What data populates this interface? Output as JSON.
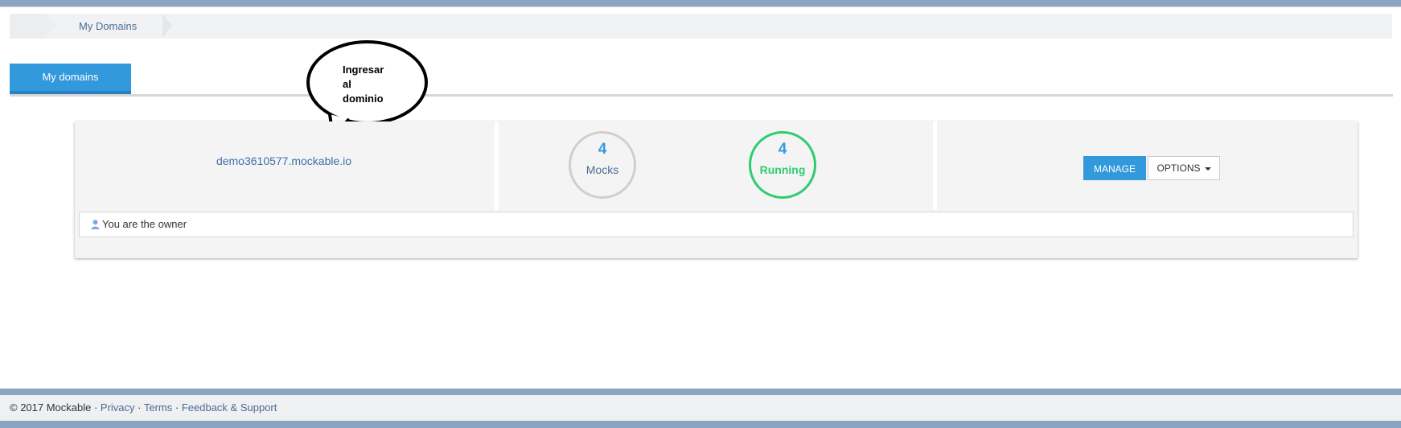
{
  "breadcrumb": {
    "current": "My Domains"
  },
  "tabs": [
    {
      "label": "My domains",
      "active": true
    }
  ],
  "callout": {
    "text": "Ingresar\nal\ndominio"
  },
  "domain": {
    "name": "demo3610577.mockable.io",
    "mocks": {
      "count": "4",
      "label": "Mocks"
    },
    "running": {
      "count": "4",
      "label": "Running"
    },
    "manage_label": "MANAGE",
    "options_label": "OPTIONS",
    "owner_text": "You are the owner"
  },
  "footer": {
    "copyright": "© 2017 Mockable · ",
    "privacy": "Privacy",
    "sep1": " · ",
    "terms": "Terms",
    "sep2": " · ",
    "feedback": "Feedback & Support"
  },
  "colors": {
    "accent": "#3399dd",
    "running": "#2ecc71",
    "link": "#3d6fa8",
    "frame_bar": "#8aa4c2"
  },
  "icons": {
    "owner": "user-icon",
    "options_caret": "caret-down-icon"
  }
}
